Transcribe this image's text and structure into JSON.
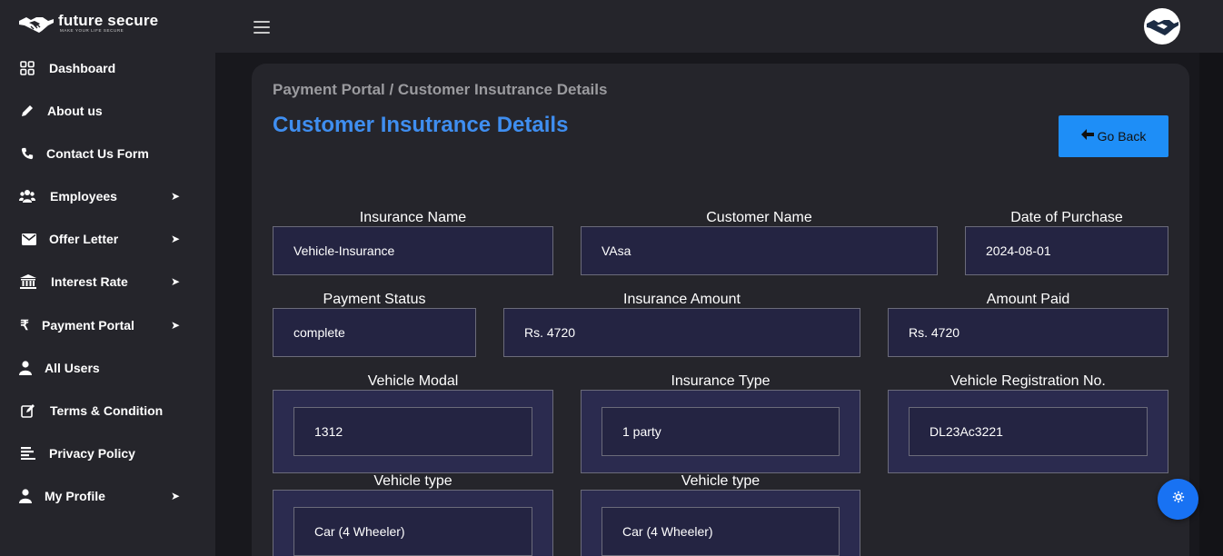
{
  "brand": {
    "name": "future secure",
    "tagline": "MAKE YOUR LIFE SECURE"
  },
  "sidebar": {
    "items": [
      {
        "label": "Dashboard",
        "icon": "grid-icon",
        "has_submenu": false
      },
      {
        "label": "About us",
        "icon": "pencil-icon",
        "has_submenu": false
      },
      {
        "label": "Contact Us Form",
        "icon": "phone-icon",
        "has_submenu": false
      },
      {
        "label": "Employees",
        "icon": "users-icon",
        "has_submenu": true
      },
      {
        "label": "Offer Letter",
        "icon": "envelope-icon",
        "has_submenu": true
      },
      {
        "label": "Interest Rate",
        "icon": "bank-icon",
        "has_submenu": true
      },
      {
        "label": "Payment Portal",
        "icon": "rupee-icon",
        "has_submenu": true
      },
      {
        "label": "All Users",
        "icon": "user-icon",
        "has_submenu": false
      },
      {
        "label": "Terms & Condition",
        "icon": "edit-icon",
        "has_submenu": false
      },
      {
        "label": "Privacy Policy",
        "icon": "align-left-icon",
        "has_submenu": false
      },
      {
        "label": "My Profile",
        "icon": "user-icon",
        "has_submenu": true
      }
    ],
    "arrow": "➤"
  },
  "main": {
    "breadcrumb": "Payment Portal / Customer Insutrance Details",
    "title": "Customer Insutrance Details",
    "go_back_label": "Go Back",
    "go_back_arrow": "🡐"
  },
  "fields": {
    "insurance_name": {
      "label": "Insurance Name",
      "value": "Vehicle-Insurance"
    },
    "customer_name": {
      "label": "Customer Name",
      "value": "VAsa"
    },
    "date_of_purchase": {
      "label": "Date of Purchase",
      "value": "2024-08-01"
    },
    "payment_status": {
      "label": "Payment Status",
      "value": "complete"
    },
    "insurance_amount": {
      "label": "Insurance Amount",
      "value": "Rs. 4720"
    },
    "amount_paid": {
      "label": "Amount Paid",
      "value": "Rs. 4720"
    },
    "vehicle_modal": {
      "label": "Vehicle Modal",
      "value": "1312"
    },
    "insurance_type": {
      "label": "Insurance Type",
      "value": "1 party"
    },
    "vehicle_registration": {
      "label": "Vehicle Registration No.",
      "value": "DL23Ac3221"
    },
    "vehicle_type_1": {
      "label": "Vehicle type",
      "value": "Car (4 Wheeler)"
    },
    "vehicle_type_2": {
      "label": "Vehicle type",
      "value": "Car (4 Wheeler)"
    }
  },
  "colors": {
    "accent": "#3f8ef0",
    "button": "#1e8ef7",
    "fab": "#1872f3",
    "field_bg": "#242442"
  },
  "fab_icon": "gear-icon"
}
